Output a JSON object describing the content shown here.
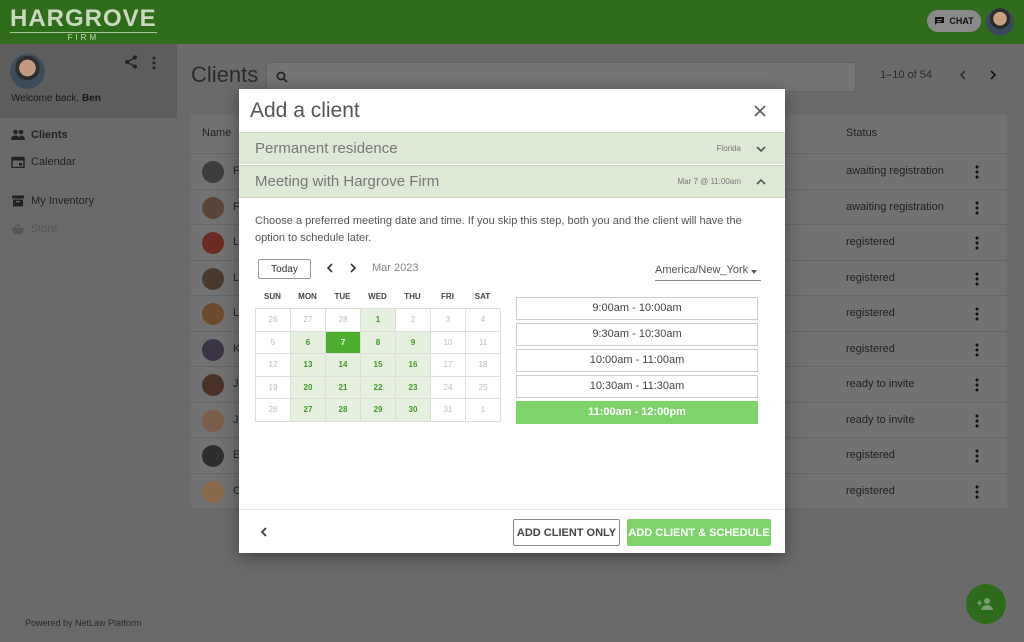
{
  "header": {
    "logo_main": "HARGROVE",
    "logo_sub": "FIRM",
    "chat_label": "CHAT"
  },
  "sidebar": {
    "welcome_prefix": "Welcome back, ",
    "user_name": "Ben",
    "items": [
      {
        "label": "Clients",
        "icon": "people-icon"
      },
      {
        "label": "Calendar",
        "icon": "calendar-icon"
      },
      {
        "label": "My Inventory",
        "icon": "archive-icon"
      },
      {
        "label": "Store",
        "icon": "basket-icon"
      }
    ],
    "powered_by": "Powered by NetLaw Platform"
  },
  "main": {
    "title": "Clients",
    "pager": "1–10 of 54",
    "columns": {
      "name": "Name",
      "status": "Status"
    },
    "rows": [
      {
        "initial": "F",
        "status": "awaiting registration"
      },
      {
        "initial": "F",
        "status": "awaiting registration"
      },
      {
        "initial": "L",
        "status": "registered"
      },
      {
        "initial": "L",
        "status": "registered"
      },
      {
        "initial": "L",
        "status": "registered"
      },
      {
        "initial": "K",
        "status": "registered"
      },
      {
        "initial": "J",
        "status": "ready to invite"
      },
      {
        "initial": "J",
        "status": "ready to invite"
      },
      {
        "initial": "E",
        "status": "registered"
      },
      {
        "initial": "C",
        "status": "registered"
      }
    ]
  },
  "modal": {
    "title": "Add a client",
    "sections": [
      {
        "label": "Permanent residence",
        "value": "Florida",
        "expanded": false
      },
      {
        "label": "Meeting with Hargrove Firm",
        "value": "Mar 7 @ 11:00am",
        "expanded": true
      }
    ],
    "instructions": "Choose a preferred meeting date and time. If you skip this step, both you and the client will have the option to schedule later.",
    "today_label": "Today",
    "month_label": "Mar 2023",
    "timezone": "America/New_York",
    "weekdays": [
      "SUN",
      "MON",
      "TUE",
      "WED",
      "THU",
      "FRI",
      "SAT"
    ],
    "calendar": [
      [
        {
          "d": "26",
          "s": "out"
        },
        {
          "d": "27",
          "s": "out"
        },
        {
          "d": "28",
          "s": "out"
        },
        {
          "d": "1",
          "s": "avail"
        },
        {
          "d": "2",
          "s": "out"
        },
        {
          "d": "3",
          "s": "out"
        },
        {
          "d": "4",
          "s": "out"
        }
      ],
      [
        {
          "d": "5",
          "s": "out"
        },
        {
          "d": "6",
          "s": "avail"
        },
        {
          "d": "7",
          "s": "sel"
        },
        {
          "d": "8",
          "s": "avail"
        },
        {
          "d": "9",
          "s": "avail"
        },
        {
          "d": "10",
          "s": "out"
        },
        {
          "d": "11",
          "s": "out"
        }
      ],
      [
        {
          "d": "12",
          "s": "out"
        },
        {
          "d": "13",
          "s": "avail"
        },
        {
          "d": "14",
          "s": "avail"
        },
        {
          "d": "15",
          "s": "avail"
        },
        {
          "d": "16",
          "s": "avail"
        },
        {
          "d": "17",
          "s": "out"
        },
        {
          "d": "18",
          "s": "out"
        }
      ],
      [
        {
          "d": "19",
          "s": "out"
        },
        {
          "d": "20",
          "s": "avail"
        },
        {
          "d": "21",
          "s": "avail"
        },
        {
          "d": "22",
          "s": "avail"
        },
        {
          "d": "23",
          "s": "avail"
        },
        {
          "d": "24",
          "s": "out"
        },
        {
          "d": "25",
          "s": "out"
        }
      ],
      [
        {
          "d": "26",
          "s": "out"
        },
        {
          "d": "27",
          "s": "avail"
        },
        {
          "d": "28",
          "s": "avail"
        },
        {
          "d": "29",
          "s": "avail"
        },
        {
          "d": "30",
          "s": "avail"
        },
        {
          "d": "31",
          "s": "out"
        },
        {
          "d": "1",
          "s": "out"
        }
      ]
    ],
    "time_slots": [
      {
        "label": "9:00am - 10:00am",
        "selected": false
      },
      {
        "label": "9:30am - 10:30am",
        "selected": false
      },
      {
        "label": "10:00am - 11:00am",
        "selected": false
      },
      {
        "label": "10:30am - 11:30am",
        "selected": false
      },
      {
        "label": "11:00am - 12:00pm",
        "selected": true
      }
    ],
    "buttons": {
      "add_only": "ADD CLIENT ONLY",
      "add_schedule": "ADD CLIENT & SCHEDULE"
    }
  },
  "colors": {
    "brand_green": "#7ed36a",
    "selected_day": "#4caf2e",
    "topbar": "#2f6d1c"
  }
}
